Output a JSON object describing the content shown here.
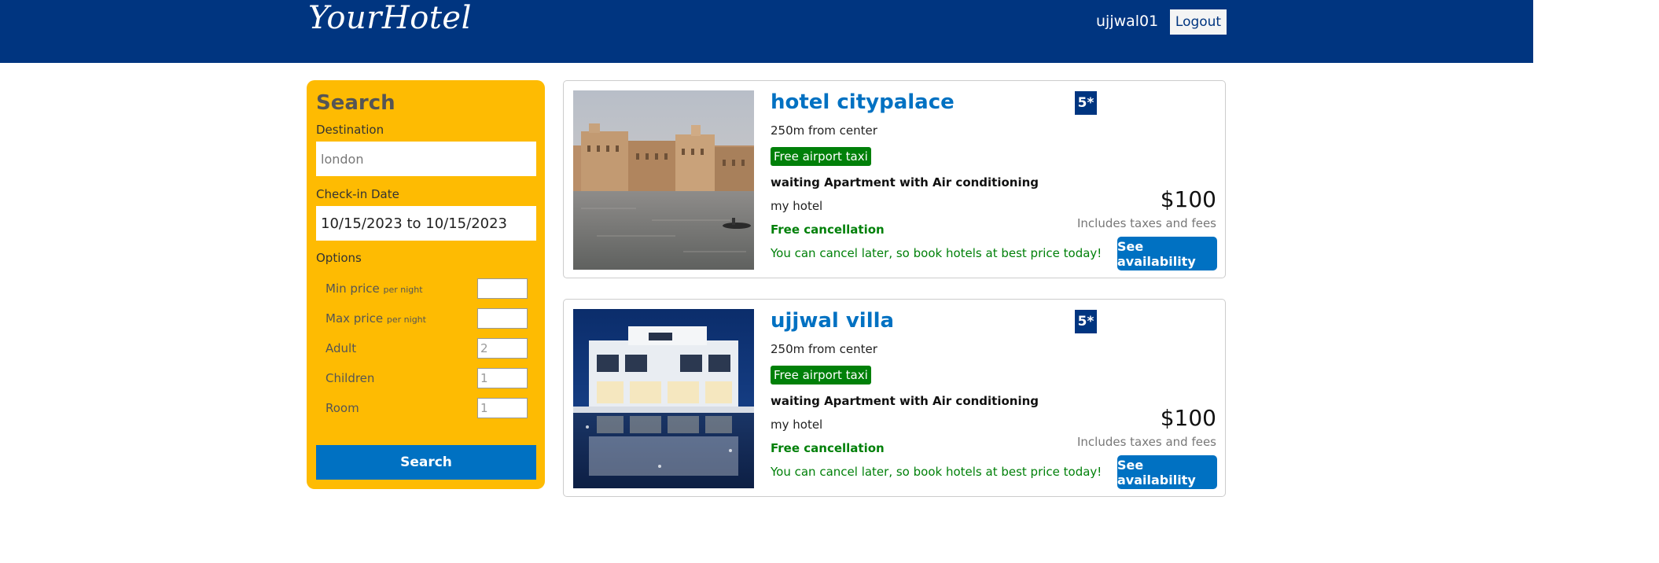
{
  "navbar": {
    "logo": "YourHotel",
    "username": "ujjwal01",
    "logout_label": "Logout",
    "bg_color": "#003580"
  },
  "search": {
    "title": "Search",
    "destination_label": "Destination",
    "destination_value": "london",
    "checkin_label": "Check-in Date",
    "checkin_value": "10/15/2023 to 10/15/2023",
    "options_label": "Options",
    "options": [
      {
        "label": "Min price",
        "sub": "per night",
        "value": ""
      },
      {
        "label": "Max price",
        "sub": "per night",
        "value": ""
      },
      {
        "label": "Adult",
        "sub": "",
        "value": "2"
      },
      {
        "label": "Children",
        "sub": "",
        "value": "1"
      },
      {
        "label": "Room",
        "sub": "",
        "value": "1"
      }
    ],
    "button_label": "Search",
    "panel_color": "#febb02"
  },
  "results": [
    {
      "name": "hotel citypalace",
      "rating": "5*",
      "distance": "250m from center",
      "taxi": "Free airport taxi",
      "subtitle": "waiting Apartment with Air conditioning",
      "features": "my hotel",
      "cancel": "Free cancellation",
      "cancel_sub": "You can cancel later, so book hotels at best price today!",
      "price": "$100",
      "tax": "Includes taxes and fees",
      "button": "See availability"
    },
    {
      "name": "ujjwal villa",
      "rating": "5*",
      "distance": "250m from center",
      "taxi": "Free airport taxi",
      "subtitle": "waiting Apartment with Air conditioning",
      "features": "my hotel",
      "cancel": "Free cancellation",
      "cancel_sub": "You can cancel later, so book hotels at best price today!",
      "price": "$100",
      "tax": "Includes taxes and fees",
      "button": "See availability"
    }
  ]
}
